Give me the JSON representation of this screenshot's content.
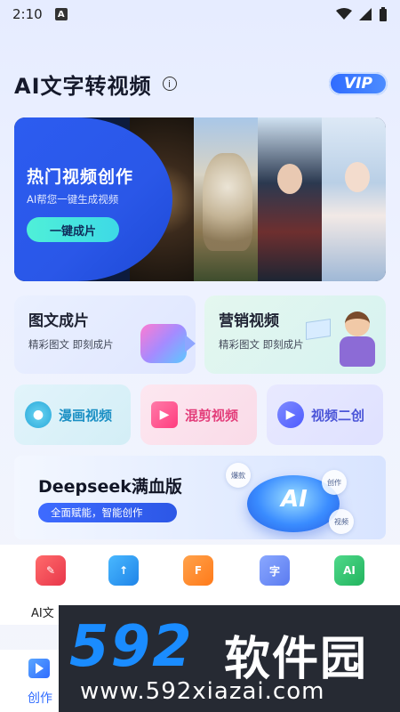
{
  "status_bar": {
    "time": "2:10",
    "notification_badge": "A"
  },
  "header": {
    "title": "AI文字转视频",
    "info_icon": "i",
    "vip_label": "VIP"
  },
  "hero": {
    "title": "热门视频创作",
    "subtitle": "AI帮您一键生成视频",
    "button_label": "一键成片"
  },
  "cards_large": [
    {
      "title": "图文成片",
      "subtitle": "精彩图文 即刻成片"
    },
    {
      "title": "营销视频",
      "subtitle": "精彩图文 即刻成片"
    }
  ],
  "cards_small": [
    {
      "label": "漫画视频"
    },
    {
      "label": "混剪视频"
    },
    {
      "label": "视频二创"
    }
  ],
  "deepseek_banner": {
    "title": "Deepseek满血版",
    "pill": "全面赋能，智能创作",
    "ai_text": "AI",
    "bubbles": [
      "爆款",
      "创作",
      "视频"
    ]
  },
  "tools": {
    "first_label": "AI文"
  },
  "watermark": {
    "number": "592",
    "brand": "软件园",
    "url": "www.592xiazai.com"
  },
  "bottom_nav": {
    "create_label": "创作"
  },
  "colors": {
    "accent": "#2f6bff",
    "manhua": "#1a8fc4",
    "hunjian": "#e33d7a",
    "erchuang": "#4b55d8"
  }
}
